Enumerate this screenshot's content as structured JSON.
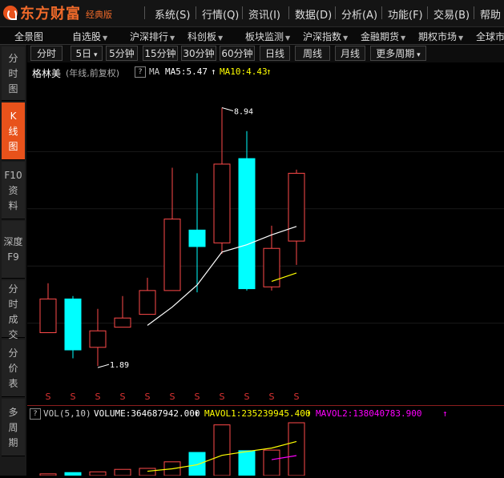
{
  "app": {
    "logo_text": "东方财富",
    "edition": "经典版"
  },
  "menu": [
    "系统(S)",
    "行情(Q)",
    "资讯(I)",
    "数据(D)",
    "分析(A)",
    "功能(F)",
    "交易(B)",
    "帮助"
  ],
  "nav": [
    {
      "label": "全景图",
      "dropdown": false
    },
    {
      "label": "自选股",
      "dropdown": true
    },
    {
      "label": "沪深排行",
      "dropdown": true
    },
    {
      "label": "科创板",
      "dropdown": true
    },
    {
      "label": "板块监测",
      "dropdown": true
    },
    {
      "label": "沪深指数",
      "dropdown": true
    },
    {
      "label": "金融期货",
      "dropdown": true
    },
    {
      "label": "期权市场",
      "dropdown": true
    },
    {
      "label": "全球市"
    }
  ],
  "sidebar": [
    {
      "label": [
        "分",
        "时",
        "图"
      ],
      "active": false
    },
    {
      "label": [
        "K",
        "线",
        "图"
      ],
      "active": true
    },
    {
      "label": [
        "F10",
        "资",
        "料"
      ],
      "active": false
    },
    {
      "label": [
        "深度",
        "F9"
      ],
      "active": false
    },
    {
      "label": [
        "分",
        "时",
        "成",
        "交"
      ],
      "active": false
    },
    {
      "label": [
        "分",
        "价",
        "表"
      ],
      "active": false
    },
    {
      "label": [
        "多",
        "周",
        "期"
      ],
      "active": false
    }
  ],
  "periods": [
    "分时",
    "5日",
    "5分钟",
    "15分钟",
    "30分钟",
    "60分钟",
    "日线",
    "周线",
    "月线",
    "更多周期"
  ],
  "info": {
    "stock_name": "格林美",
    "period_desc": "(年线,前复权)",
    "q": "?",
    "ma_label": "MA",
    "ma5": "MA5:5.47",
    "ma10": "MA10:4.43"
  },
  "vol_info": {
    "q": "?",
    "label": "VOL(5,10)",
    "volume": "VOLUME:364687942.000",
    "mavol1": "MAVOL1:235239945.400",
    "mavol2": "MAVOL2:138040783.900"
  },
  "colors": {
    "up": "#ff4a4a",
    "down": "#00ffff",
    "ma5": "#ffffff",
    "ma10": "#ffff00",
    "mavol2": "#ff00ff",
    "accent": "#e8521b"
  },
  "markers": {
    "high_label": "8.94",
    "low_label": "1.89",
    "s_symbol": "S"
  },
  "chart_data": {
    "type": "candlestick",
    "title": "格林美",
    "subtitle": "(年线,前复权)",
    "ylim": [
      1.5,
      9.3
    ],
    "candles": [
      {
        "open": 2.8,
        "close": 3.72,
        "high": 4.15,
        "low": 2.8,
        "dir": "up"
      },
      {
        "open": 3.72,
        "close": 2.33,
        "high": 3.8,
        "low": 2.1,
        "dir": "down"
      },
      {
        "open": 2.4,
        "close": 2.85,
        "high": 3.45,
        "low": 1.89,
        "dir": "up"
      },
      {
        "open": 2.95,
        "close": 3.2,
        "high": 3.8,
        "low": 2.95,
        "dir": "up"
      },
      {
        "open": 3.3,
        "close": 3.95,
        "high": 4.3,
        "low": 3.3,
        "dir": "up"
      },
      {
        "open": 3.95,
        "close": 5.9,
        "high": 7.3,
        "low": 3.95,
        "dir": "up"
      },
      {
        "open": 5.6,
        "close": 5.15,
        "high": 7.15,
        "low": 3.9,
        "dir": "down"
      },
      {
        "open": 5.25,
        "close": 7.4,
        "high": 8.94,
        "low": 4.95,
        "dir": "up"
      },
      {
        "open": 7.55,
        "close": 4.0,
        "high": 8.3,
        "low": 3.95,
        "dir": "down"
      },
      {
        "open": 4.05,
        "close": 5.1,
        "high": 5.72,
        "low": 3.95,
        "dir": "up"
      },
      {
        "open": 5.3,
        "close": 7.15,
        "high": 7.25,
        "low": 4.65,
        "dir": "up"
      }
    ],
    "ma5": [
      null,
      null,
      null,
      null,
      3.0,
      3.5,
      4.1,
      5.0,
      5.2,
      5.47,
      5.7
    ],
    "ma10": [
      null,
      null,
      null,
      null,
      null,
      null,
      null,
      null,
      null,
      4.2,
      4.43
    ],
    "volume": {
      "ylim": [
        0,
        364687942
      ],
      "values": [
        12000000,
        21000000,
        26000000,
        43000000,
        50000000,
        95000000,
        160000000,
        350000000,
        172000000,
        176000000,
        364687942
      ],
      "dir": [
        "up",
        "down",
        "up",
        "up",
        "up",
        "up",
        "down",
        "up",
        "down",
        "up",
        "up"
      ],
      "mavol1": [
        null,
        null,
        null,
        null,
        30000000,
        47000000,
        75000000,
        140000000,
        166000000,
        190000000,
        235239945
      ],
      "mavol2": [
        null,
        null,
        null,
        null,
        null,
        null,
        null,
        null,
        null,
        110000000,
        138040784
      ]
    }
  }
}
